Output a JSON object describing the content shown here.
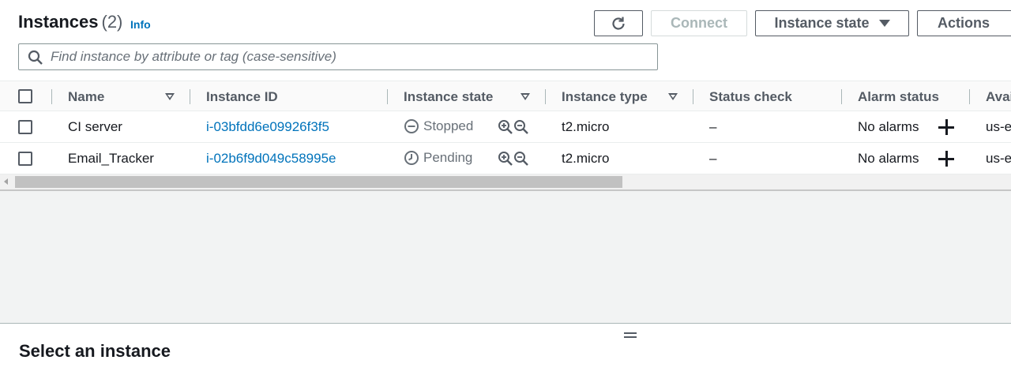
{
  "header": {
    "title": "Instances",
    "count": "(2)",
    "info_link": "Info",
    "connect_label": "Connect",
    "instance_state_label": "Instance state",
    "actions_label": "Actions"
  },
  "search": {
    "placeholder": "Find instance by attribute or tag (case-sensitive)",
    "value": ""
  },
  "table": {
    "columns": [
      "Name",
      "Instance ID",
      "Instance state",
      "Instance type",
      "Status check",
      "Alarm status",
      "Avai"
    ],
    "rows": [
      {
        "name": "CI server",
        "instance_id": "i-03bfdd6e09926f3f5",
        "state": "Stopped",
        "state_icon": "stopped-icon",
        "type": "t2.micro",
        "status_check": "–",
        "alarm": "No alarms",
        "az": "us-e"
      },
      {
        "name": "Email_Tracker",
        "instance_id": "i-02b6f9d049c58995e",
        "state": "Pending",
        "state_icon": "pending-clock-icon",
        "type": "t2.micro",
        "status_check": "–",
        "alarm": "No alarms",
        "az": "us-e"
      }
    ]
  },
  "detail_panel": {
    "title": "Select an instance"
  },
  "colors": {
    "link": "#0073bb",
    "text": "#16191f",
    "muted": "#545b64",
    "panel_bg": "#f2f3f3"
  }
}
